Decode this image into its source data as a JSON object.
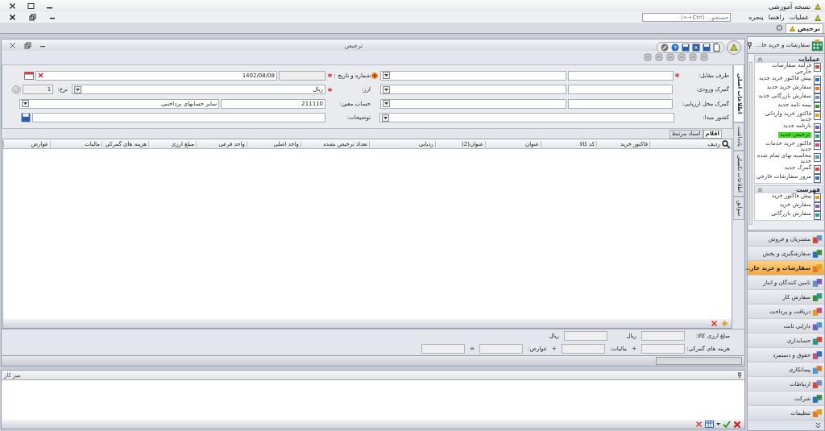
{
  "app_title": "نسخه آموزشی",
  "menu": [
    {
      "label": "عملیات"
    },
    {
      "label": "راهنما"
    },
    {
      "label": "پنجره"
    }
  ],
  "search": {
    "placeholder": "جستجو... (Ctrl+=)"
  },
  "doc_tabs": [
    {
      "label": "ترخیص",
      "selected": true
    }
  ],
  "window": {
    "title": "ترخیص"
  },
  "side_tabs": [
    {
      "label": "اطلاعات اصلی",
      "selected": true
    },
    {
      "label": "یادداشت",
      "selected": false
    },
    {
      "label": "اطلاعات تکمیلی",
      "selected": false
    },
    {
      "label": "سوابق",
      "selected": false
    }
  ],
  "form": {
    "counterparty": {
      "label": "طرف مقابل:",
      "required": true
    },
    "entry_customs": {
      "label": "گمرک ورودی:",
      "required": false
    },
    "valuation_customs": {
      "label": "گمرک محل ارزیابی:",
      "required": false
    },
    "origin_country": {
      "label": "کشور مبدا:",
      "required": false
    },
    "number_date": {
      "label": "شماره و تاریخ :",
      "required": true,
      "date": "1402/08/08"
    },
    "currency": {
      "label": "ارز:",
      "required": true,
      "value": "ریال",
      "rate_label": "نرخ:",
      "rate": "1"
    },
    "account": {
      "label": "حساب معین:",
      "required": false,
      "code": "211110",
      "name": "سایر حسابهای پرداختنی"
    },
    "notes": {
      "label": "توضیحات:",
      "required": false
    }
  },
  "item_tabs": [
    {
      "label": "اقلام",
      "selected": true
    },
    {
      "label": "اسناد مرتبط",
      "selected": false
    }
  ],
  "table": {
    "columns": [
      "ردیف",
      "فاکتور خرید",
      "کد کالا",
      "عنوان",
      "عنوان(2)",
      "ردیابی",
      "تعداد ترخیص نشده",
      "واحد اصلی",
      "واحد فرعی",
      "مبلغ ارزی",
      "هزینه های گمرکی",
      "مالیات",
      "عوارض"
    ]
  },
  "totals": {
    "currency_amount_label": "مبلغ ارزی کالا:",
    "unit_1": "ریال",
    "unit_2": "ریال",
    "customs_label": "هزینه های گمرکی:",
    "plus_1": "+",
    "tax_label": "مالیات:",
    "plus_2": "+",
    "duties_label": "عوارض:",
    "equals": "="
  },
  "workspace": {
    "title": "میز کار"
  },
  "sidebar": {
    "title": "سفارشات و خرید خا...",
    "sections": [
      {
        "title": "عملیات",
        "items": [
          {
            "label": "فرآیند سفارشات خارجی",
            "selected": false
          },
          {
            "label": "پیش فاکتور خرید جدید",
            "selected": false
          },
          {
            "label": "سفارش خرید جدید",
            "selected": false
          },
          {
            "label": "سفارش بازرگانی جدید",
            "selected": false
          },
          {
            "label": "بیمه نامه جدید",
            "selected": false
          },
          {
            "label": "فاکتور خرید وارداتی جدید",
            "selected": false
          },
          {
            "label": "بارنامه جدید",
            "selected": false
          },
          {
            "label": "ترخیص جدید",
            "selected": true
          },
          {
            "label": "فاکتور خرید خدمات جدید",
            "selected": false
          },
          {
            "label": "محاسبه بهای تمام شده جدید",
            "selected": false
          },
          {
            "label": "گمرک جدید",
            "selected": false
          },
          {
            "label": "مرور سفارشات خارجی",
            "selected": false
          }
        ]
      },
      {
        "title": "فهرست",
        "items": [
          {
            "label": "پیش فاکتور خرید",
            "selected": false
          },
          {
            "label": "سفارش خرید",
            "selected": false
          },
          {
            "label": "سفارش بازرگانی",
            "selected": false
          }
        ]
      }
    ],
    "modules": [
      {
        "label": "مشتریان و فروش",
        "selected": false
      },
      {
        "label": "سفارشگیری و پخش",
        "selected": false
      },
      {
        "label": "سفارشات و خرید خار...",
        "selected": true
      },
      {
        "label": "تامین کنندگان و انبار",
        "selected": false
      },
      {
        "label": "سفارش کار",
        "selected": false
      },
      {
        "label": "دریافت و پرداخت",
        "selected": false
      },
      {
        "label": "دارایی ثابت",
        "selected": false
      },
      {
        "label": "حسابداری",
        "selected": false
      },
      {
        "label": "حقوق و دستمزد",
        "selected": false
      },
      {
        "label": "پیمانکاری",
        "selected": false
      },
      {
        "label": "ارتباطات",
        "selected": false
      },
      {
        "label": "شرکت",
        "selected": false
      },
      {
        "label": "تنظیمات",
        "selected": false
      }
    ]
  }
}
